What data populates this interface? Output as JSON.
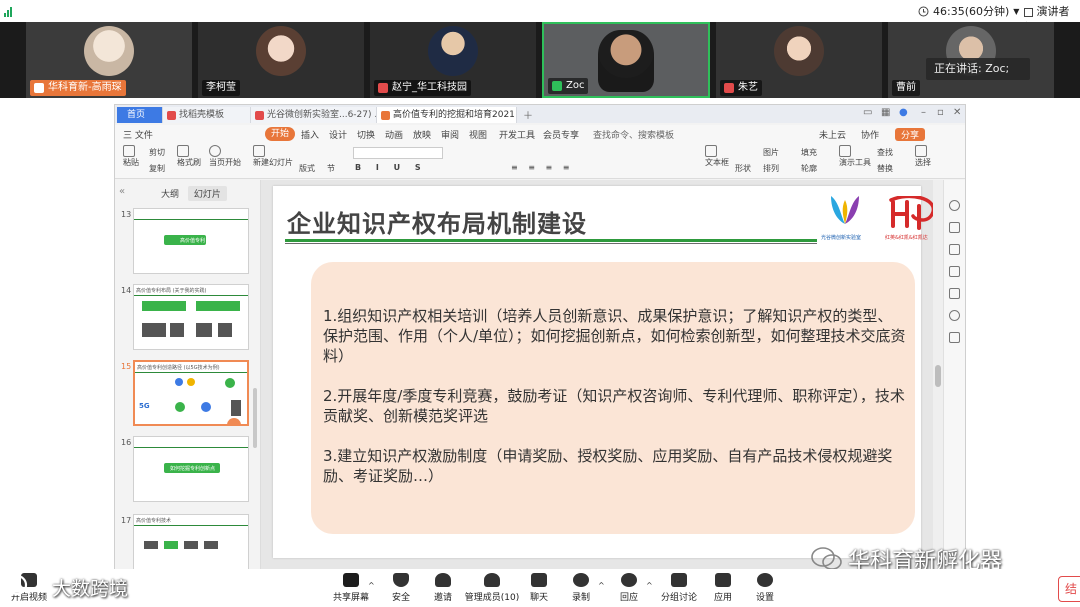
{
  "status": {
    "timer": "46:35(60分钟)",
    "presenter_view": "演讲者视图"
  },
  "video": {
    "participants": [
      {
        "name": "华科育新-高雨琛"
      },
      {
        "name": "李柯莹"
      },
      {
        "name": "赵宁_华工科技园"
      },
      {
        "name": "Zoc"
      },
      {
        "name": "朱艺"
      },
      {
        "name": "曹前"
      }
    ],
    "speaking_label": "正在讲话: Zoc;"
  },
  "wps": {
    "tabs": [
      {
        "label": "首页"
      },
      {
        "label": "找稻壳模板"
      },
      {
        "label": "光谷微创新实验室...6-27) .pdf"
      },
      {
        "label": "高价值专利的挖掘和培育2021"
      }
    ],
    "menu": [
      "三 文件",
      "开始",
      "插入",
      "设计",
      "切换",
      "动画",
      "放映",
      "审阅",
      "视图",
      "开发工具",
      "会员专享",
      "查找命令、搜索模板",
      "未上云",
      "协作",
      "分享"
    ],
    "ribbon": [
      "粘贴",
      "剪切",
      "复制",
      "格式刷",
      "当页开始",
      "新建幻灯片",
      "版式",
      "节",
      "文本框",
      "形状",
      "排列",
      "图片",
      "填充",
      "轮廓",
      "演示工具",
      "查找",
      "替换",
      "选择"
    ],
    "left_panel": {
      "tabs": [
        "大纲",
        "幻灯片"
      ],
      "slides": [
        {
          "num": "13",
          "caption": "高价值专利"
        },
        {
          "num": "14",
          "caption": "高价值专利布局 (关于我的实践)"
        },
        {
          "num": "15",
          "caption": "高价值专利创造路径 (以5G技术为例)"
        },
        {
          "num": "16",
          "caption": "如何挖掘专利创新点"
        },
        {
          "num": "17",
          "caption": "高价值专利技术"
        }
      ]
    },
    "slide": {
      "title": "企业知识产权布局机制建设",
      "logo1_caption": "光谷微创新实验室",
      "logo2_caption": "红英&红凯&红凯达",
      "paragraphs": [
        "1.组织知识产权相关培训（培养人员创新意识、成果保护意识；了解知识产权的类型、保护范围、作用（个人/单位）；如何挖掘创新点，如何检索创新型，如何整理技术交底资料）",
        "2.开展年度/季度专利竞赛，鼓励考证（知识产权咨询师、专利代理师、职称评定），技术贡献奖、创新模范奖评选",
        "3.建立知识产权激励制度（申请奖励、授权奖励、应用奖励、自有产品技术侵权规避奖励、考证奖励…）"
      ]
    }
  },
  "toolbar": {
    "items": [
      {
        "label": "开启视频"
      },
      {
        "label": "共享屏幕"
      },
      {
        "label": "安全"
      },
      {
        "label": "邀请"
      },
      {
        "label": "管理成员(10)"
      },
      {
        "label": "聊天"
      },
      {
        "label": "录制"
      },
      {
        "label": "回应"
      },
      {
        "label": "分组讨论"
      },
      {
        "label": "应用"
      },
      {
        "label": "设置"
      }
    ],
    "end_label": "结"
  },
  "watermarks": {
    "right": "华科育新孵化器",
    "left": "大数跨境"
  },
  "colors": {
    "accent_green": "#2e9a3d",
    "content_box": "#fbe5d6",
    "start_tab": "#e8763a",
    "active_speaker": "#2fbf5a"
  }
}
